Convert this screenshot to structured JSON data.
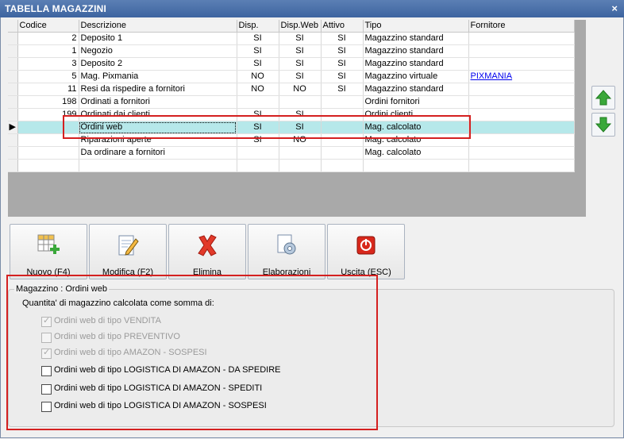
{
  "window": {
    "title": "TABELLA MAGAZZINI",
    "close": "×"
  },
  "grid": {
    "columns": [
      "Codice",
      "Descrizione",
      "Disp.",
      "Disp.Web",
      "Attivo",
      "Tipo",
      "Fornitore"
    ],
    "rows": [
      {
        "codice": "2",
        "descrizione": "Deposito 1",
        "disp": "SI",
        "dispweb": "SI",
        "attivo": "SI",
        "tipo": "Magazzino standard",
        "fornitore": ""
      },
      {
        "codice": "1",
        "descrizione": "Negozio",
        "disp": "SI",
        "dispweb": "SI",
        "attivo": "SI",
        "tipo": "Magazzino standard",
        "fornitore": ""
      },
      {
        "codice": "3",
        "descrizione": "Deposito 2",
        "disp": "SI",
        "dispweb": "SI",
        "attivo": "SI",
        "tipo": "Magazzino standard",
        "fornitore": ""
      },
      {
        "codice": "5",
        "descrizione": "Mag. Pixmania",
        "disp": "NO",
        "dispweb": "SI",
        "attivo": "SI",
        "tipo": "Magazzino virtuale",
        "fornitore": "PIXMANIA"
      },
      {
        "codice": "11",
        "descrizione": "Resi da rispedire a fornitori",
        "disp": "NO",
        "dispweb": "NO",
        "attivo": "SI",
        "tipo": "Magazzino standard",
        "fornitore": ""
      },
      {
        "codice": "198",
        "descrizione": "Ordinati a fornitori",
        "disp": "",
        "dispweb": "",
        "attivo": "",
        "tipo": "Ordini fornitori",
        "fornitore": ""
      },
      {
        "codice": "199",
        "descrizione": "Ordinati dai clienti",
        "disp": "SI",
        "dispweb": "SI",
        "attivo": "",
        "tipo": "Ordini clienti",
        "fornitore": ""
      },
      {
        "codice": "",
        "descrizione": "Ordini web",
        "disp": "SI",
        "dispweb": "SI",
        "attivo": "",
        "tipo": "Mag. calcolato",
        "fornitore": ""
      },
      {
        "codice": "",
        "descrizione": "Riparazioni aperte",
        "disp": "SI",
        "dispweb": "NO",
        "attivo": "",
        "tipo": "Mag. calcolato",
        "fornitore": ""
      },
      {
        "codice": "",
        "descrizione": "Da ordinare a fornitori",
        "disp": "",
        "dispweb": "",
        "attivo": "",
        "tipo": "Mag. calcolato",
        "fornitore": ""
      },
      {
        "codice": "",
        "descrizione": "",
        "disp": "",
        "dispweb": "",
        "attivo": "",
        "tipo": "",
        "fornitore": ""
      }
    ],
    "current_row_indicator": "▶"
  },
  "toolbar": {
    "nuovo": "Nuovo (F4)",
    "modifica": "Modifica (F2)",
    "elimina": "Elimina",
    "elaborazioni": "Elaborazioni",
    "uscita": "Uscita (ESC)"
  },
  "panel": {
    "title": "Magazzino : Ordini web",
    "subtitle": "Quantita' di magazzino calcolata come somma di:",
    "options": [
      {
        "label": "Ordini web di tipo VENDITA",
        "checked": true,
        "enabled": false
      },
      {
        "label": "Ordini web di tipo PREVENTIVO",
        "checked": false,
        "enabled": false
      },
      {
        "label": "Ordini web di tipo AMAZON - SOSPESI",
        "checked": true,
        "enabled": false
      },
      {
        "label": "Ordini web di tipo LOGISTICA DI AMAZON - DA SPEDIRE",
        "checked": false,
        "enabled": true
      },
      {
        "label": "Ordini web di tipo LOGISTICA DI AMAZON - SPEDITI",
        "checked": false,
        "enabled": true
      },
      {
        "label": "Ordini web di tipo LOGISTICA DI AMAZON - SOSPESI",
        "checked": false,
        "enabled": true
      }
    ]
  },
  "colors": {
    "titlebar": "#3d64a0",
    "current_row": "#b6e8ea",
    "highlight": "#d42020",
    "arrows": "#3aa83a"
  }
}
